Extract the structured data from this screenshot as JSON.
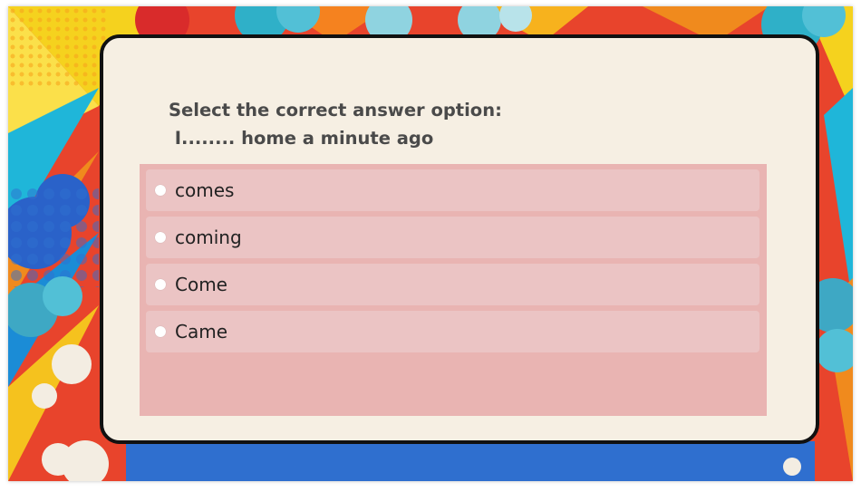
{
  "question": {
    "prompt": "Select the correct answer option:",
    "sentence": " I........ home a minute ago"
  },
  "options": [
    {
      "label": "comes"
    },
    {
      "label": "coming"
    },
    {
      "label": "Come"
    },
    {
      "label": "Came"
    }
  ],
  "colors": {
    "card_background": "#f6efe3",
    "options_panel": "#e9b4b2",
    "option_row": "#ebc4c4",
    "question_text": "#4a4a4a"
  }
}
